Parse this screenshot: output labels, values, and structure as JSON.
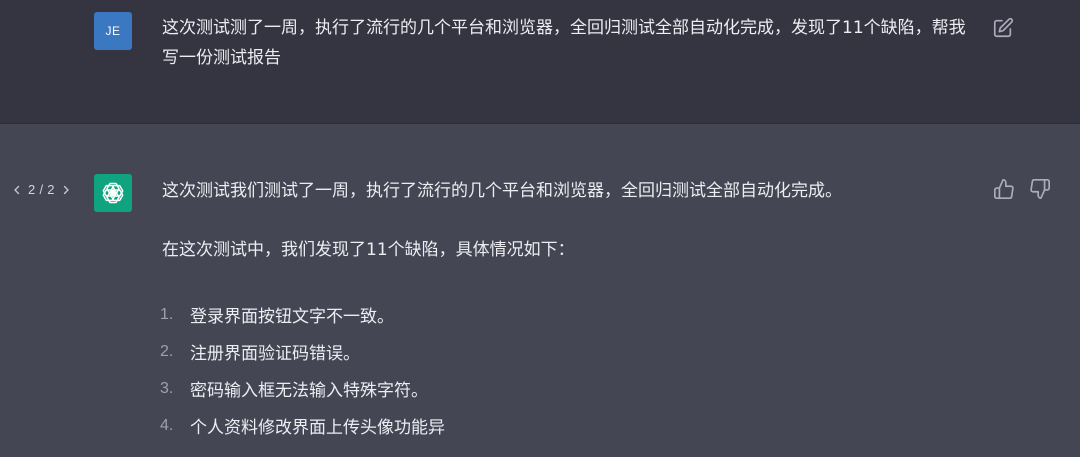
{
  "user_message": {
    "avatar_initials": "JE",
    "text": "这次测试测了一周，执行了流行的几个平台和浏览器，全回归测试全部自动化完成，发现了11个缺陷，帮我写一份测试报告"
  },
  "assistant_message": {
    "pager": {
      "current": "2",
      "total": "2",
      "label": "2 / 2"
    },
    "paragraph1": "这次测试我们测试了一周，执行了流行的几个平台和浏览器，全回归测试全部自动化完成。",
    "paragraph2": "在这次测试中，我们发现了11个缺陷，具体情况如下：",
    "list": [
      {
        "num": "1.",
        "text": "登录界面按钮文字不一致。"
      },
      {
        "num": "2.",
        "text": "注册界面验证码错误。"
      },
      {
        "num": "3.",
        "text": "密码输入框无法输入特殊字符。"
      },
      {
        "num": "4.",
        "text": "个人资料修改界面上传头像功能异"
      }
    ]
  },
  "icons": {
    "edit": "edit-icon",
    "thumbs_up": "thumbs-up-icon",
    "thumbs_down": "thumbs-down-icon",
    "prev": "chevron-left-icon",
    "next": "chevron-right-icon",
    "assistant_logo": "openai-logo-icon"
  },
  "colors": {
    "user_bg": "#343541",
    "assistant_bg": "#444654",
    "user_avatar": "#3a78c2",
    "assistant_avatar": "#10a37f",
    "text": "#ececf1"
  }
}
